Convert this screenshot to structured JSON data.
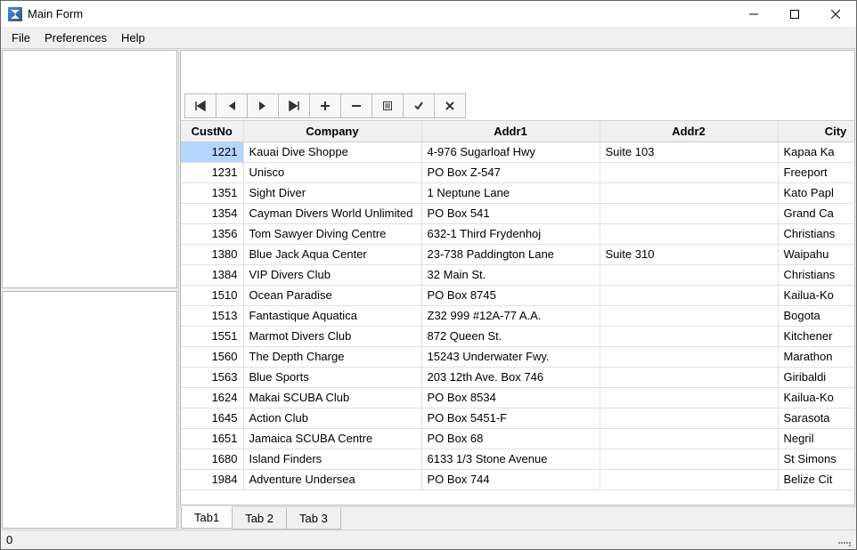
{
  "window": {
    "title": "Main Form"
  },
  "menu": {
    "file": "File",
    "preferences": "Preferences",
    "help": "Help"
  },
  "grid": {
    "columns": [
      "CustNo",
      "Company",
      "Addr1",
      "Addr2",
      "City"
    ],
    "rows": [
      {
        "custno": "1221",
        "company": "Kauai Dive Shoppe",
        "addr1": "4-976 Sugarloaf Hwy",
        "addr2": "Suite 103",
        "city": "Kapaa Ka"
      },
      {
        "custno": "1231",
        "company": "Unisco",
        "addr1": "PO Box Z-547",
        "addr2": "",
        "city": "Freeport"
      },
      {
        "custno": "1351",
        "company": "Sight Diver",
        "addr1": "1 Neptune Lane",
        "addr2": "",
        "city": "Kato Papl"
      },
      {
        "custno": "1354",
        "company": "Cayman Divers World Unlimited",
        "addr1": "PO Box 541",
        "addr2": "",
        "city": "Grand Ca"
      },
      {
        "custno": "1356",
        "company": "Tom Sawyer Diving Centre",
        "addr1": "632-1 Third Frydenhoj",
        "addr2": "",
        "city": "Christians"
      },
      {
        "custno": "1380",
        "company": "Blue Jack Aqua Center",
        "addr1": "23-738 Paddington Lane",
        "addr2": "Suite 310",
        "city": "Waipahu"
      },
      {
        "custno": "1384",
        "company": "VIP Divers Club",
        "addr1": "32 Main St.",
        "addr2": "",
        "city": "Christians"
      },
      {
        "custno": "1510",
        "company": "Ocean Paradise",
        "addr1": "PO Box 8745",
        "addr2": "",
        "city": "Kailua-Ko"
      },
      {
        "custno": "1513",
        "company": "Fantastique Aquatica",
        "addr1": "Z32 999 #12A-77 A.A.",
        "addr2": "",
        "city": "Bogota"
      },
      {
        "custno": "1551",
        "company": "Marmot Divers Club",
        "addr1": "872 Queen St.",
        "addr2": "",
        "city": "Kitchener"
      },
      {
        "custno": "1560",
        "company": "The Depth Charge",
        "addr1": "15243 Underwater Fwy.",
        "addr2": "",
        "city": "Marathon"
      },
      {
        "custno": "1563",
        "company": "Blue Sports",
        "addr1": "203 12th Ave. Box 746",
        "addr2": "",
        "city": "Giribaldi"
      },
      {
        "custno": "1624",
        "company": "Makai SCUBA Club",
        "addr1": "PO Box 8534",
        "addr2": "",
        "city": "Kailua-Ko"
      },
      {
        "custno": "1645",
        "company": "Action Club",
        "addr1": "PO Box 5451-F",
        "addr2": "",
        "city": "Sarasota"
      },
      {
        "custno": "1651",
        "company": "Jamaica SCUBA Centre",
        "addr1": "PO Box 68",
        "addr2": "",
        "city": "Negril"
      },
      {
        "custno": "1680",
        "company": "Island Finders",
        "addr1": "6133 1/3 Stone Avenue",
        "addr2": "",
        "city": "St Simons"
      },
      {
        "custno": "1984",
        "company": "Adventure Undersea",
        "addr1": "PO Box 744",
        "addr2": "",
        "city": "Belize Cit"
      }
    ],
    "selected_row": 0,
    "selected_col": "custno"
  },
  "tabs": {
    "items": [
      "Tab1",
      "Tab 2",
      "Tab 3"
    ],
    "active": 0
  },
  "status": {
    "text": "0"
  }
}
